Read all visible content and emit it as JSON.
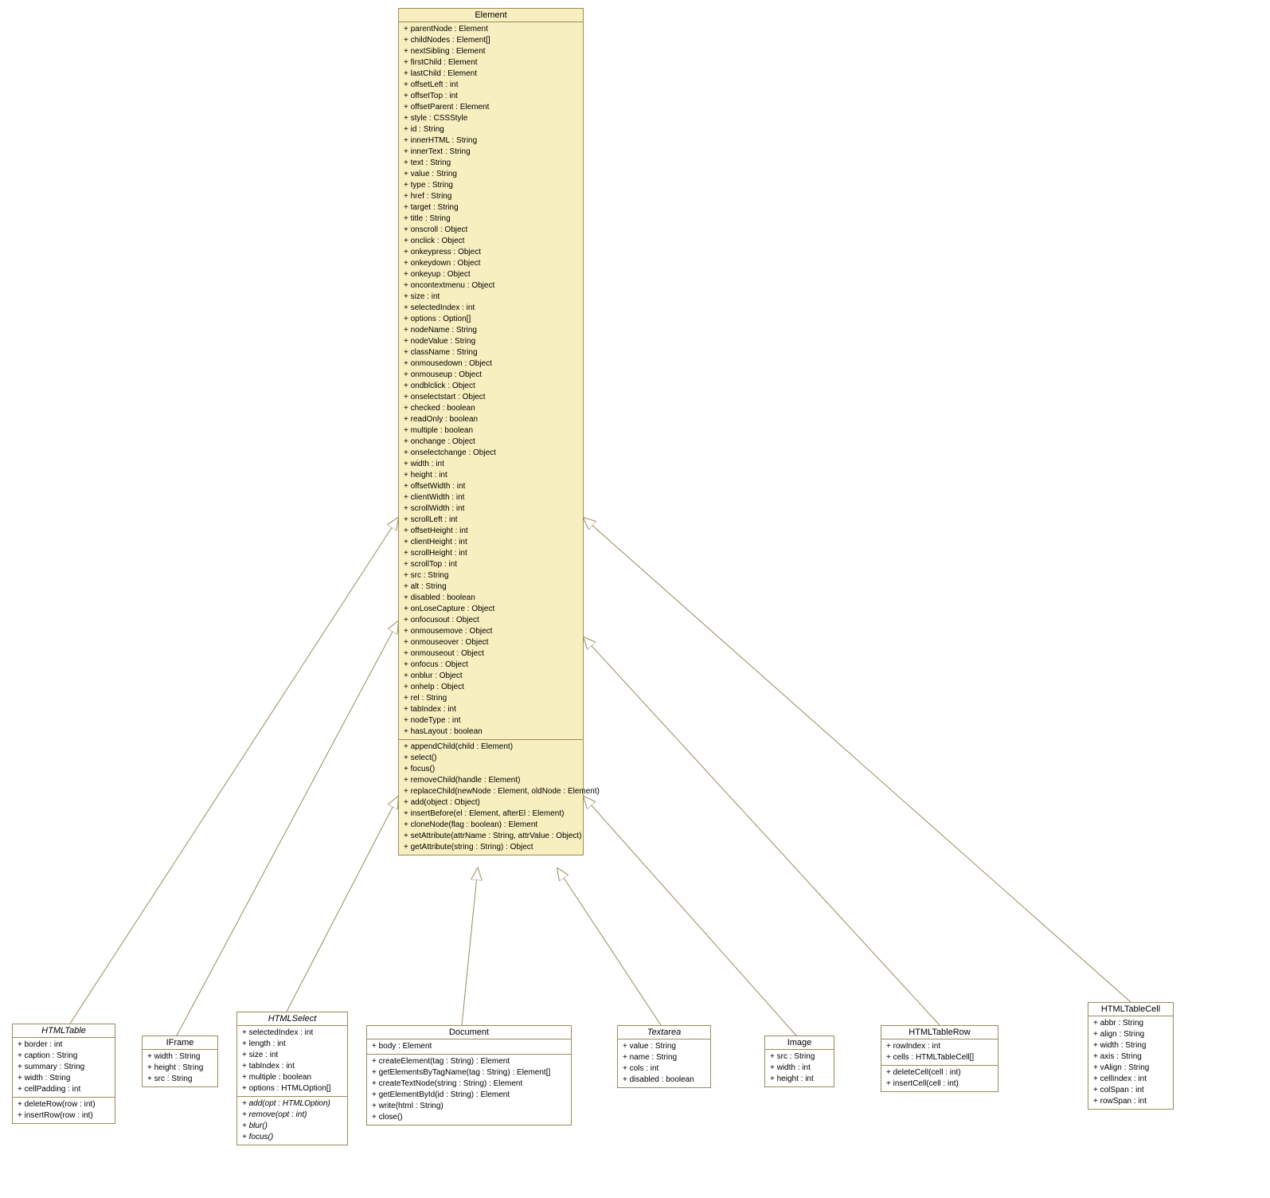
{
  "classes": {
    "Element": {
      "title": "Element",
      "attrs": [
        "+ parentNode : Element",
        "+ childNodes : Element[]",
        "+ nextSibling : Element",
        "+ firstChild : Element",
        "+ lastChild : Element",
        "+ offsetLeft : int",
        "+ offsetTop : int",
        "+ offsetParent : Element",
        "+ style : CSSStyle",
        "+ id : String",
        "+ innerHTML : String",
        "+ innerText : String",
        "+ text : String",
        "+ value : String",
        "+ type : String",
        "+ href : String",
        "+ target : String",
        "+ title : String",
        "+ onscroll : Object",
        "+ onclick : Object",
        "+ onkeypress : Object",
        "+ onkeydown : Object",
        "+ onkeyup : Object",
        "+ oncontextmenu : Object",
        "+ size : int",
        "+ selectedIndex : int",
        "+ options : Option[]",
        "+ nodeName : String",
        "+ nodeValue : String",
        "+ className : String",
        "+ onmousedown : Object",
        "+ onmouseup : Object",
        "+ ondblclick : Object",
        "+ onselectstart : Object",
        "+ checked : boolean",
        "+ readOnly : boolean",
        "+ multiple : boolean",
        "+ onchange : Object",
        "+ onselectchange : Object",
        "+ width : int",
        "+ height : int",
        "+ offsetWidth : int",
        "+ clientWidth : int",
        "+ scrollWidth : int",
        "+ scrollLeft : int",
        "+ offsetHeight : int",
        "+ clientHeight : int",
        "+ scrollHeight : int",
        "+ scrollTop : int",
        "+ src : String",
        "+ alt : String",
        "+ disabled : boolean",
        "+ onLoseCapture : Object",
        "+ onfocusout : Object",
        "+ onmousemove : Object",
        "+ onmouseover : Object",
        "+ onmouseout : Object",
        "+ onfocus : Object",
        "+ onblur : Object",
        "+ onhelp : Object",
        "+ rel : String",
        "+ tabIndex : int",
        "+ nodeType : int",
        "+ hasLayout : boolean"
      ],
      "ops": [
        "+ appendChild(child : Element)",
        "+ select()",
        "+ focus()",
        "+ removeChild(handle : Element)",
        "+ replaceChild(newNode : Element, oldNode : Element)",
        "+ add(object : Object)",
        "+ insertBefore(el : Element, afterEl : Element)",
        "+ cloneNode(flag : boolean) : Element",
        "+ setAttribute(attrName : String, attrValue : Object)",
        "+ getAttribute(string : String) : Object"
      ]
    },
    "HTMLTable": {
      "title": "HTMLTable",
      "italic": true,
      "attrs": [
        "+ border : int",
        "+ caption : String",
        "+ summary : String",
        "+ width : String",
        "+ cellPadding : int"
      ],
      "ops": [
        "+ deleteRow(row : int)",
        "+ insertRow(row : int)"
      ]
    },
    "IFrame": {
      "title": "IFrame",
      "attrs": [
        "+ width : String",
        "+ height : String",
        "+ src : String"
      ],
      "ops": []
    },
    "HTMLSelect": {
      "title": "HTMLSelect",
      "italic": true,
      "attrs": [
        "+ selectedIndex : int",
        "+ length : int",
        "+ size : int",
        "+ tabIndex : int",
        "+ multiple : boolean",
        "+ options : HTMLOption[]"
      ],
      "ops_italic": [
        "+ add(opt : HTMLOption)",
        "+ remove(opt : int)",
        "+ blur()",
        "+ focus()"
      ]
    },
    "Document": {
      "title": "Document",
      "attrs": [
        "+ body : Element"
      ],
      "ops": [
        "+ createElement(tag : String) : Element",
        "+ getElementsByTagName(tag : String) : Element[]",
        "+ createTextNode(string : String) : Element",
        "+ getElementById(id : String) : Element",
        "+ write(html : String)",
        "+ close()"
      ]
    },
    "Textarea": {
      "title": "Textarea",
      "italic": true,
      "attrs": [
        "+ value : String",
        "+ name : String",
        "+ cols : int",
        "+ disabled : boolean"
      ],
      "ops": []
    },
    "Image": {
      "title": "Image",
      "attrs": [
        "+ src : String",
        "+ width : int",
        "+ height : int"
      ],
      "ops": []
    },
    "HTMLTableRow": {
      "title": "HTMLTableRow",
      "attrs": [
        "+ rowIndex : int",
        "+ cells : HTMLTableCell[]"
      ],
      "ops": [
        "+ deleteCell(cell : int)",
        "+ insertCell(cell : int)"
      ]
    },
    "HTMLTableCell": {
      "title": "HTMLTableCell",
      "attrs": [
        "+ abbr : String",
        "+ align : String",
        "+ width : String",
        "+ axis : String",
        "+ vAlign : String",
        "+ cellIndex : int",
        "+ colSpan : int",
        "+ rowSpan : int"
      ],
      "ops": []
    }
  }
}
